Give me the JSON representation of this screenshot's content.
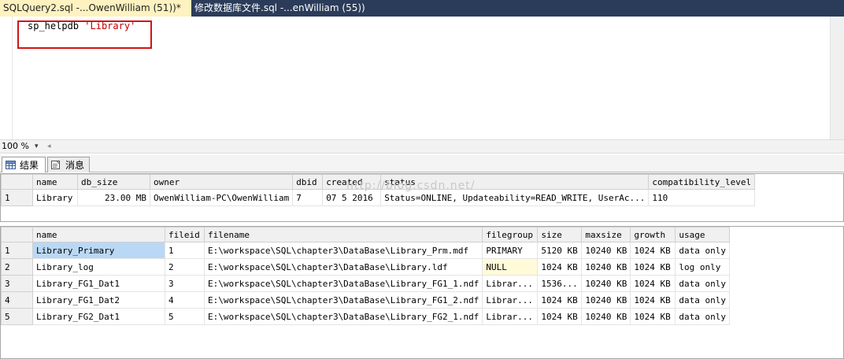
{
  "tabs": [
    {
      "label": "SQLQuery2.sql -...OwenWilliam (51))*",
      "active": true
    },
    {
      "label": "修改数据库文件.sql -...enWilliam (55))",
      "active": false
    }
  ],
  "editor": {
    "code_keyword": "sp_helpdb",
    "code_string": "'Library'"
  },
  "zoom": {
    "value": "100 %"
  },
  "result_tabs": [
    {
      "label": "结果",
      "icon": "grid-icon",
      "active": true
    },
    {
      "label": "消息",
      "icon": "message-icon",
      "active": false
    }
  ],
  "grid1": {
    "headers": [
      "name",
      "db_size",
      "owner",
      "dbid",
      "created",
      "status",
      "compatibility_level"
    ],
    "rows": [
      [
        "1",
        "Library",
        "23.00 MB",
        "OwenWilliam-PC\\OwenWilliam",
        "7",
        "07  5 2016",
        "Status=ONLINE, Updateability=READ_WRITE, UserAc...",
        "110"
      ]
    ]
  },
  "grid2": {
    "headers": [
      "name",
      "fileid",
      "filename",
      "filegroup",
      "size",
      "maxsize",
      "growth",
      "usage"
    ],
    "rows": [
      [
        "1",
        "Library_Primary",
        "1",
        "E:\\workspace\\SQL\\chapter3\\DataBase\\Library_Prm.mdf",
        "PRIMARY",
        "5120 KB",
        "10240 KB",
        "1024 KB",
        "data only"
      ],
      [
        "2",
        "Library_log",
        "2",
        "E:\\workspace\\SQL\\chapter3\\DataBase\\Library.ldf",
        "NULL",
        "1024 KB",
        "10240 KB",
        "1024 KB",
        "log only"
      ],
      [
        "3",
        "Library_FG1_Dat1",
        "3",
        "E:\\workspace\\SQL\\chapter3\\DataBase\\Library_FG1_1.ndf",
        "Librar...",
        "1536...",
        "10240 KB",
        "1024 KB",
        "data only"
      ],
      [
        "4",
        "Library_FG1_Dat2",
        "4",
        "E:\\workspace\\SQL\\chapter3\\DataBase\\Library_FG1_2.ndf",
        "Librar...",
        "1024 KB",
        "10240 KB",
        "1024 KB",
        "data only"
      ],
      [
        "5",
        "Library_FG2_Dat1",
        "5",
        "E:\\workspace\\SQL\\chapter3\\DataBase\\Library_FG2_1.ndf",
        "Librar...",
        "1024 KB",
        "10240 KB",
        "1024 KB",
        "data only"
      ]
    ]
  },
  "watermark": "http://blog.csdn.net/",
  "colors": {
    "tabstrip": "#2b3c5a",
    "active_tab": "#fdf2c0",
    "highlight_box": "#d21414",
    "selected_cell": "#b9d8f5"
  }
}
